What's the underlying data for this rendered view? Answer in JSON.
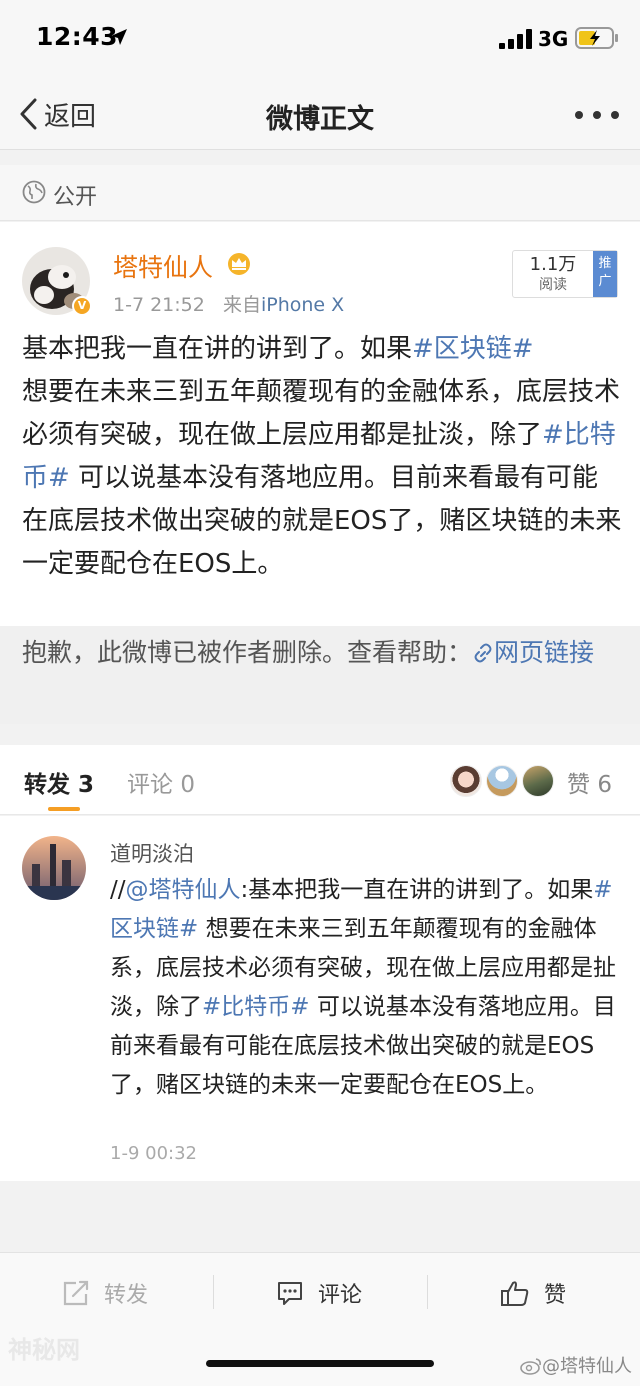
{
  "status": {
    "time": "12:43",
    "network": "3G"
  },
  "nav": {
    "back_label": "返回",
    "title": "微博正文"
  },
  "visibility": {
    "label": "公开"
  },
  "post": {
    "author": "塔特仙人",
    "date": "1-7 21:52",
    "source_prefix": "来自",
    "source": "iPhone X",
    "reads_count": "1.1万",
    "reads_label": "阅读",
    "promote_label": "推广",
    "text": {
      "p1": "基本把我一直在讲的讲到了。如果",
      "tag1": "#区块链#",
      "p2": "想要在未来三到五年颠覆现有的金融体系，底层技术必须有突破，现在做上层应用都是扯淡，除了",
      "tag2": "#比特币#",
      "p3": " 可以说基本没有落地应用。目前来看最有可能在底层技术做出突破的就是EOS了，赌区块链的未来一定要配仓在EOS上。"
    }
  },
  "deleted_notice": {
    "text": "抱歉，此微博已被作者删除。查看帮助：",
    "link_label": "网页链接"
  },
  "tabs": {
    "repost_label": "转发",
    "repost_count": "3",
    "comment_label": "评论",
    "comment_count": "0",
    "like_label": "赞",
    "like_count": "6"
  },
  "repost_item": {
    "user": "道明淡泊",
    "prefix": "//",
    "mention": "@塔特仙人",
    "p1": ":基本把我一直在讲的讲到了。如果",
    "tag1": "#区块链#",
    "p2": " 想要在未来三到五年颠覆现有的金融体系，底层技术必须有突破，现在做上层应用都是扯淡，除了",
    "tag2": "#比特币#",
    "p3": " 可以说基本没有落地应用。目前来看最有可能在底层技术做出突破的就是EOS了，赌区块链的未来一定要配仓在EOS上。",
    "time": "1-9 00:32"
  },
  "toolbar": {
    "repost_label": "转发",
    "comment_label": "评论",
    "like_label": "赞"
  },
  "watermark": "@塔特仙人",
  "watermark_left": "神秘网"
}
